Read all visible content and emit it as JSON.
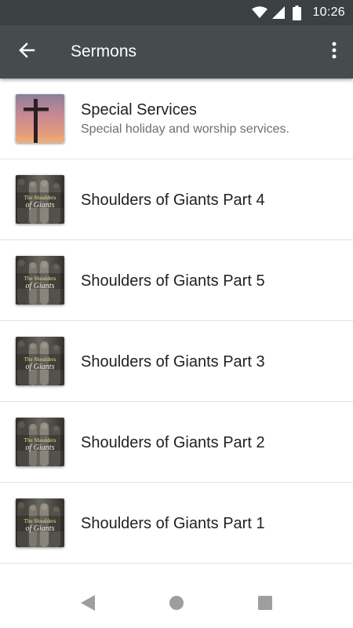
{
  "status_bar": {
    "time": "10:26",
    "icons": [
      "wifi-icon",
      "cell-signal-icon",
      "battery-icon"
    ]
  },
  "app_bar": {
    "title": "Sermons",
    "background_color": "#464c4c",
    "back_icon": "arrow-back-icon",
    "menu_icon": "more-vertical-icon"
  },
  "items": [
    {
      "title": "Special Services",
      "subtitle": "Special holiday and worship services.",
      "thumb": "cross-sunset-image"
    },
    {
      "title": "Shoulders of Giants Part 4",
      "thumb": "shoulders-of-giants-artwork"
    },
    {
      "title": "Shoulders of Giants Part 5",
      "thumb": "shoulders-of-giants-artwork"
    },
    {
      "title": "Shoulders of Giants Part 3",
      "thumb": "shoulders-of-giants-artwork"
    },
    {
      "title": "Shoulders of Giants Part 2",
      "thumb": "shoulders-of-giants-artwork"
    },
    {
      "title": "Shoulders of Giants Part 1",
      "thumb": "shoulders-of-giants-artwork"
    }
  ],
  "artwork": {
    "line1": "The Shoulders",
    "line2": "of Giants"
  },
  "nav_bar": {
    "icons": [
      "back-triangle-icon",
      "home-circle-icon",
      "recents-square-icon"
    ]
  }
}
